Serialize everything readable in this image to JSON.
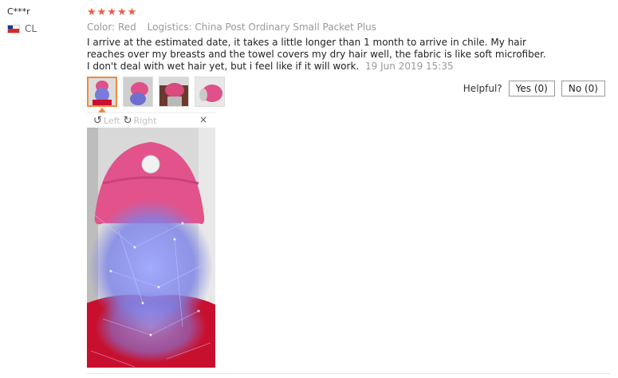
{
  "reviewer": {
    "name": "C***r",
    "country": "CL"
  },
  "review": {
    "rating": 5,
    "color_label": "Color:",
    "color_value": "Red",
    "logistics_label": "Logistics:",
    "logistics_value": "China Post Ordinary Small Packet Plus",
    "text": "I arrive at the estimated date, it takes a little longer than 1 month to arrive in chile. My hair reaches over my breasts and the towel covers my dry hair well, the fabric is like soft microfiber. I don't deal with wet hair yet, but i feel like if it will work.",
    "date": "19 Jun 2019 15:35"
  },
  "helpful": {
    "label": "Helpful?",
    "yes": "Yes (0)",
    "no": "No (0)"
  },
  "viewer": {
    "left": "Left",
    "right": "Right",
    "close": "×"
  },
  "icons": {
    "star": "★",
    "rotate_left": "rotate-left-icon",
    "rotate_right": "rotate-right-icon",
    "close": "close-icon"
  },
  "colors": {
    "star": "#f05a44",
    "towel": "#e0508a",
    "shirt": "#c8102e",
    "active_thumb": "#f08a3c"
  }
}
